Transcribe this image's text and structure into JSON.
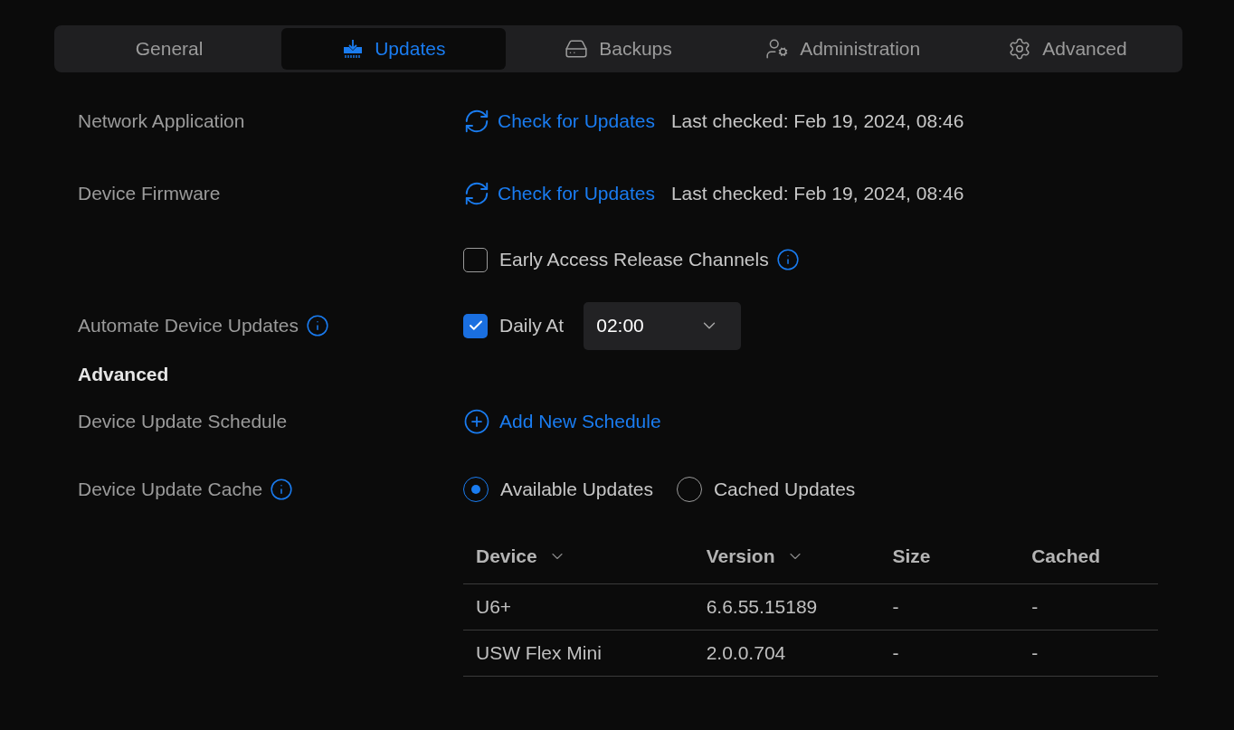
{
  "tabs": [
    {
      "label": "General",
      "selected": false
    },
    {
      "label": "Updates",
      "selected": true
    },
    {
      "label": "Backups",
      "selected": false
    },
    {
      "label": "Administration",
      "selected": false
    },
    {
      "label": "Advanced",
      "selected": false
    }
  ],
  "network_application": {
    "label": "Network Application",
    "action": "Check for Updates",
    "last_checked": "Last checked: Feb 19, 2024, 08:46"
  },
  "device_firmware": {
    "label": "Device Firmware",
    "action": "Check for Updates",
    "last_checked": "Last checked: Feb 19, 2024, 08:46",
    "early_access": {
      "label": "Early Access Release Channels",
      "checked": false
    }
  },
  "automate_device_updates": {
    "label": "Automate Device Updates",
    "checkbox": {
      "label": "Daily At",
      "checked": true
    },
    "time": "02:00"
  },
  "advanced_heading": "Advanced",
  "device_update_schedule": {
    "label": "Device Update Schedule",
    "action": "Add New Schedule"
  },
  "device_update_cache": {
    "label": "Device Update Cache",
    "options": [
      {
        "label": "Available Updates",
        "selected": true
      },
      {
        "label": "Cached Updates",
        "selected": false
      }
    ]
  },
  "table": {
    "columns": [
      {
        "label": "Device",
        "sortable": true
      },
      {
        "label": "Version",
        "sortable": true
      },
      {
        "label": "Size",
        "sortable": false
      },
      {
        "label": "Cached",
        "sortable": false
      }
    ],
    "rows": [
      [
        "U6+",
        "6.6.55.15189",
        "-",
        "-"
      ],
      [
        "USW Flex Mini",
        "2.0.0.704",
        "-",
        "-"
      ]
    ]
  }
}
